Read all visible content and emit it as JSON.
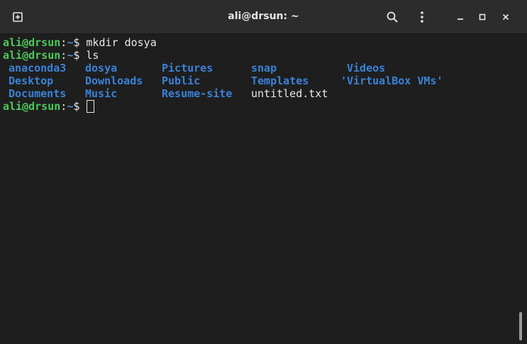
{
  "window": {
    "title": "ali@drsun: ~"
  },
  "titlebar": {
    "new_tab_icon": "new-tab-icon",
    "search_icon": "search-icon",
    "menu_icon": "kebab-menu-icon",
    "minimize_icon": "minimize-icon",
    "maximize_icon": "maximize-icon",
    "close_icon": "close-icon"
  },
  "terminal": {
    "prompt_user": "ali@drsun",
    "prompt_colon": ":",
    "prompt_path": "~",
    "prompt_symbol": "$ ",
    "commands": [
      "mkdir dosya",
      "ls",
      ""
    ],
    "ls_rows": [
      [
        "anaconda3",
        "dosya",
        "Pictures",
        "snap",
        "Videos"
      ],
      [
        "Desktop",
        "Downloads",
        "Public",
        "Templates",
        "'VirtualBox VMs'"
      ],
      [
        "Documents",
        "Music",
        "Resume-site",
        "untitled.txt",
        ""
      ]
    ]
  },
  "colors": {
    "background": "#1e1e1e",
    "titlebar": "#2c2c2c",
    "prompt_user": "#4ec95a",
    "prompt_path": "#4b8fde",
    "directory": "#3b82d8",
    "text": "#e8e8e8"
  }
}
